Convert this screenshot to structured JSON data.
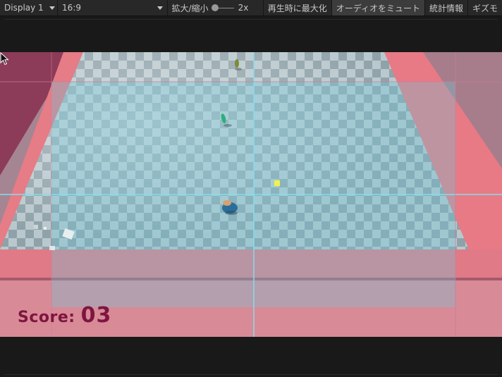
{
  "toolbar": {
    "display_label": "Display 1",
    "aspect_label": "16:9",
    "zoom_label": "拡大/縮小",
    "zoom_value": "2x",
    "maximize_label": "再生時に最大化",
    "mute_label": "オーディオをミュート",
    "stats_label": "統計情報",
    "gizmos_label": "ギズモ"
  },
  "game": {
    "score_label": "Score:",
    "score_value": "03"
  },
  "colors": {
    "toolbar_bg": "#282828",
    "score_text": "#7e1540",
    "wall_pink": "#e37782",
    "guide_cyan": "#7fd6e6"
  }
}
